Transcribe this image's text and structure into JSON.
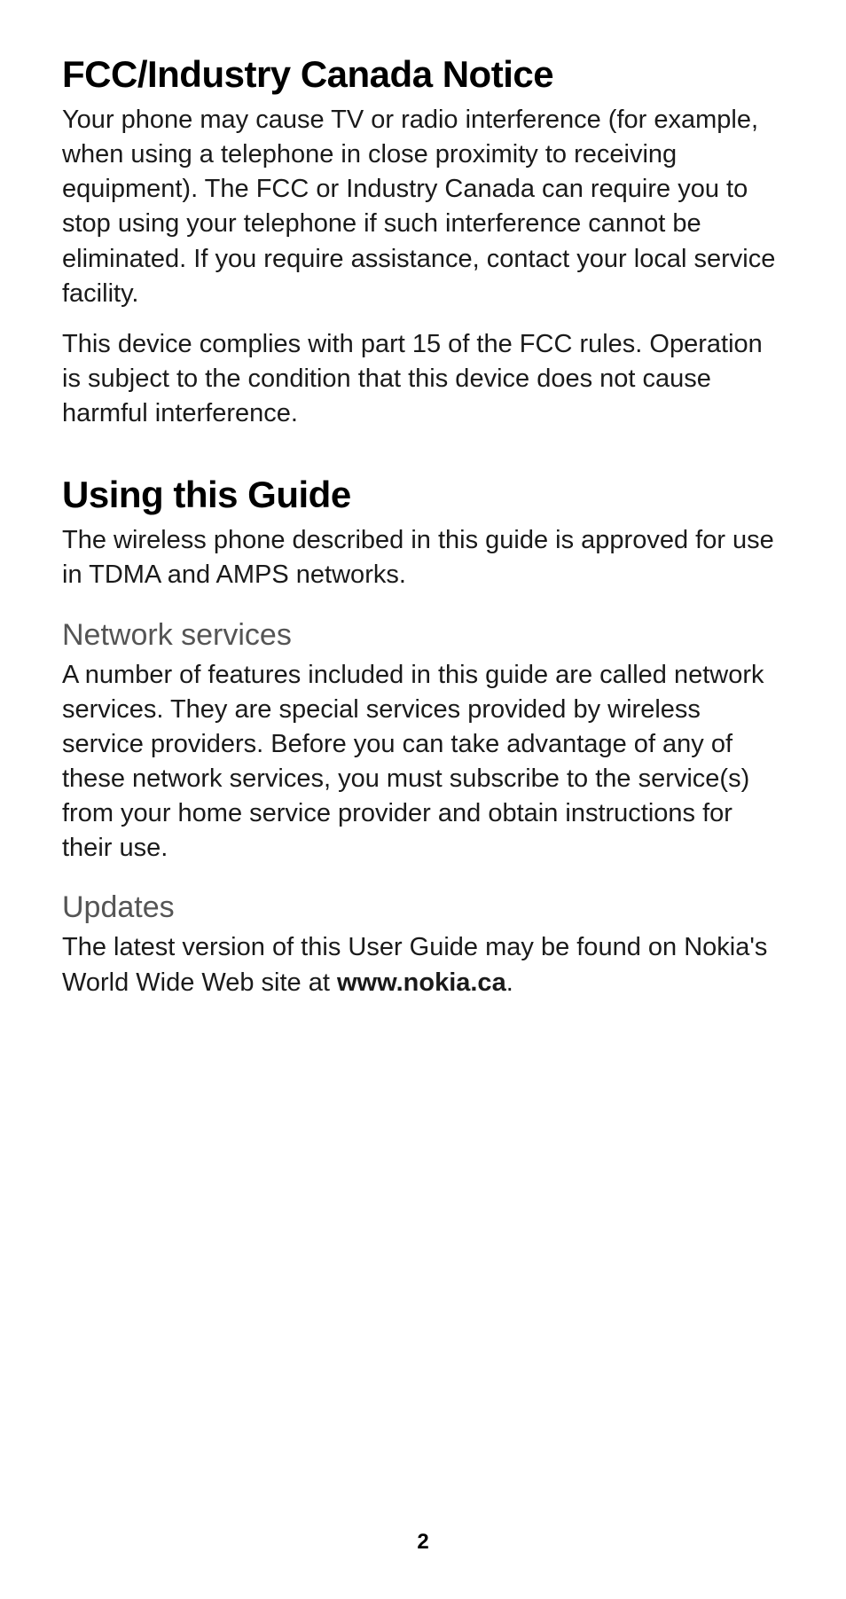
{
  "sections": {
    "fcc": {
      "heading": "FCC/Industry Canada Notice",
      "p1": "Your phone may cause TV or radio interference (for example, when using a telephone in close proximity to receiving equipment). The FCC or Industry Canada can require you to stop using your telephone if such interference cannot be eliminated. If you require assistance, contact your local service facility.",
      "p2": "This device complies with part 15 of the FCC rules. Operation is subject to the condition that this device does not cause harmful interference."
    },
    "guide": {
      "heading": "Using this Guide",
      "p1": "The wireless phone described in this guide is approved for use in TDMA and AMPS networks."
    },
    "network": {
      "heading": "Network services",
      "p1": "A number of features included in this guide are called network services. They are special services provided by wireless service providers. Before you can take advantage of any of these network services, you must subscribe to the service(s) from your home service provider and obtain instructions for their use."
    },
    "updates": {
      "heading": "Updates",
      "p1_prefix": "The latest version of this User Guide may be found on Nokia's World Wide Web site at ",
      "p1_bold": "www.nokia.ca",
      "p1_suffix": "."
    }
  },
  "page_number": "2"
}
